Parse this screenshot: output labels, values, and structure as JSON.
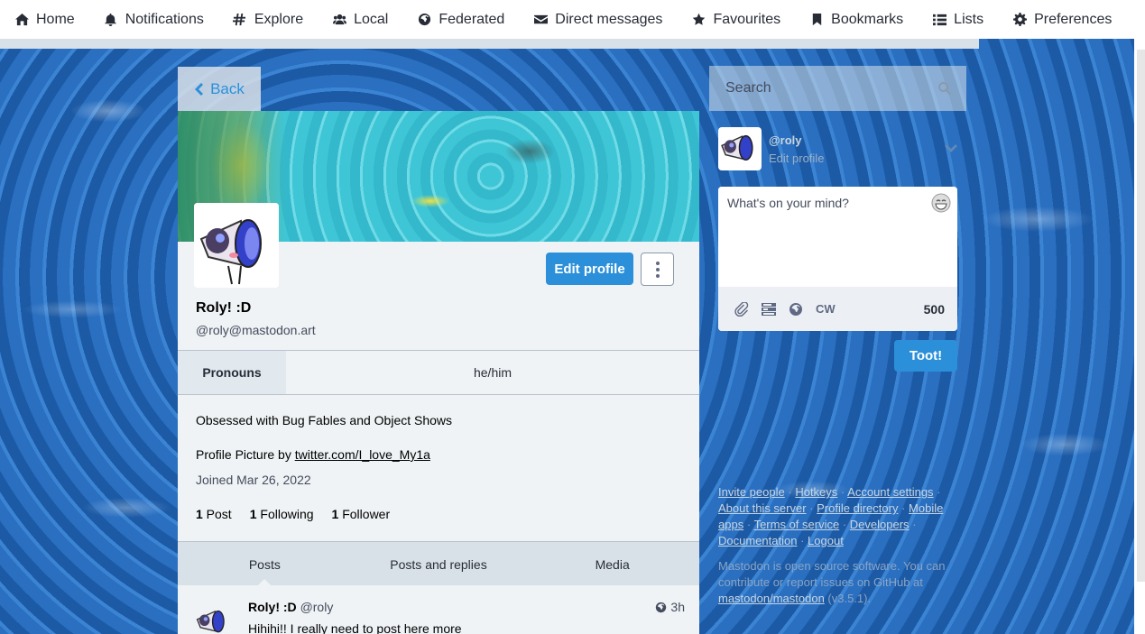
{
  "nav": {
    "items": [
      {
        "label": "Home",
        "icon": "home-icon"
      },
      {
        "label": "Notifications",
        "icon": "bell-icon"
      },
      {
        "label": "Explore",
        "icon": "hashtag-icon"
      },
      {
        "label": "Local",
        "icon": "users-icon"
      },
      {
        "label": "Federated",
        "icon": "globe-icon"
      },
      {
        "label": "Direct messages",
        "icon": "envelope-icon"
      },
      {
        "label": "Favourites",
        "icon": "star-icon"
      },
      {
        "label": "Bookmarks",
        "icon": "bookmark-icon"
      },
      {
        "label": "Lists",
        "icon": "list-icon"
      },
      {
        "label": "Preferences",
        "icon": "gear-icon"
      }
    ]
  },
  "back_label": "Back",
  "profile": {
    "edit_label": "Edit profile",
    "display_name": "Roly! :D",
    "handle": "@roly@mastodon.art",
    "field_key": "Pronouns",
    "field_value": "he/him",
    "bio_line1": "Obsessed with Bug Fables and Object Shows",
    "bio_line2_prefix": "Profile Picture by ",
    "bio_link": "twitter.com/I_love_My1a",
    "joined": "Joined Mar 26, 2022",
    "counts": {
      "posts_num": "1",
      "posts_label": " Post",
      "following_num": "1",
      "following_label": " Following",
      "followers_num": "1",
      "followers_label": " Follower"
    },
    "tabs": [
      "Posts",
      "Posts and replies",
      "Media"
    ]
  },
  "post": {
    "author": "Roly! :D",
    "handle": "@roly",
    "time": "3h",
    "text": "Hihihi!! I really need to post here more"
  },
  "search": {
    "placeholder": "Search"
  },
  "me": {
    "handle": "@roly",
    "edit_label": "Edit profile"
  },
  "compose": {
    "placeholder": "What's on your mind?",
    "cw_label": "CW",
    "char_count": "500",
    "submit_label": "Toot!"
  },
  "footer": {
    "links": [
      "Invite people",
      "Hotkeys",
      "Account settings",
      "About this server",
      "Profile directory",
      "Mobile apps",
      "Terms of service",
      "Developers",
      "Documentation",
      "Logout"
    ],
    "about_prefix": "Mastodon is open source software. You can contribute or report issues on GitHub at ",
    "repo": "mastodon/mastodon",
    "version": " (v3.5.1)."
  },
  "colors": {
    "accent": "#2b90d9",
    "nav_bg": "#ffffff",
    "panel_bg": "#eff3f5"
  }
}
